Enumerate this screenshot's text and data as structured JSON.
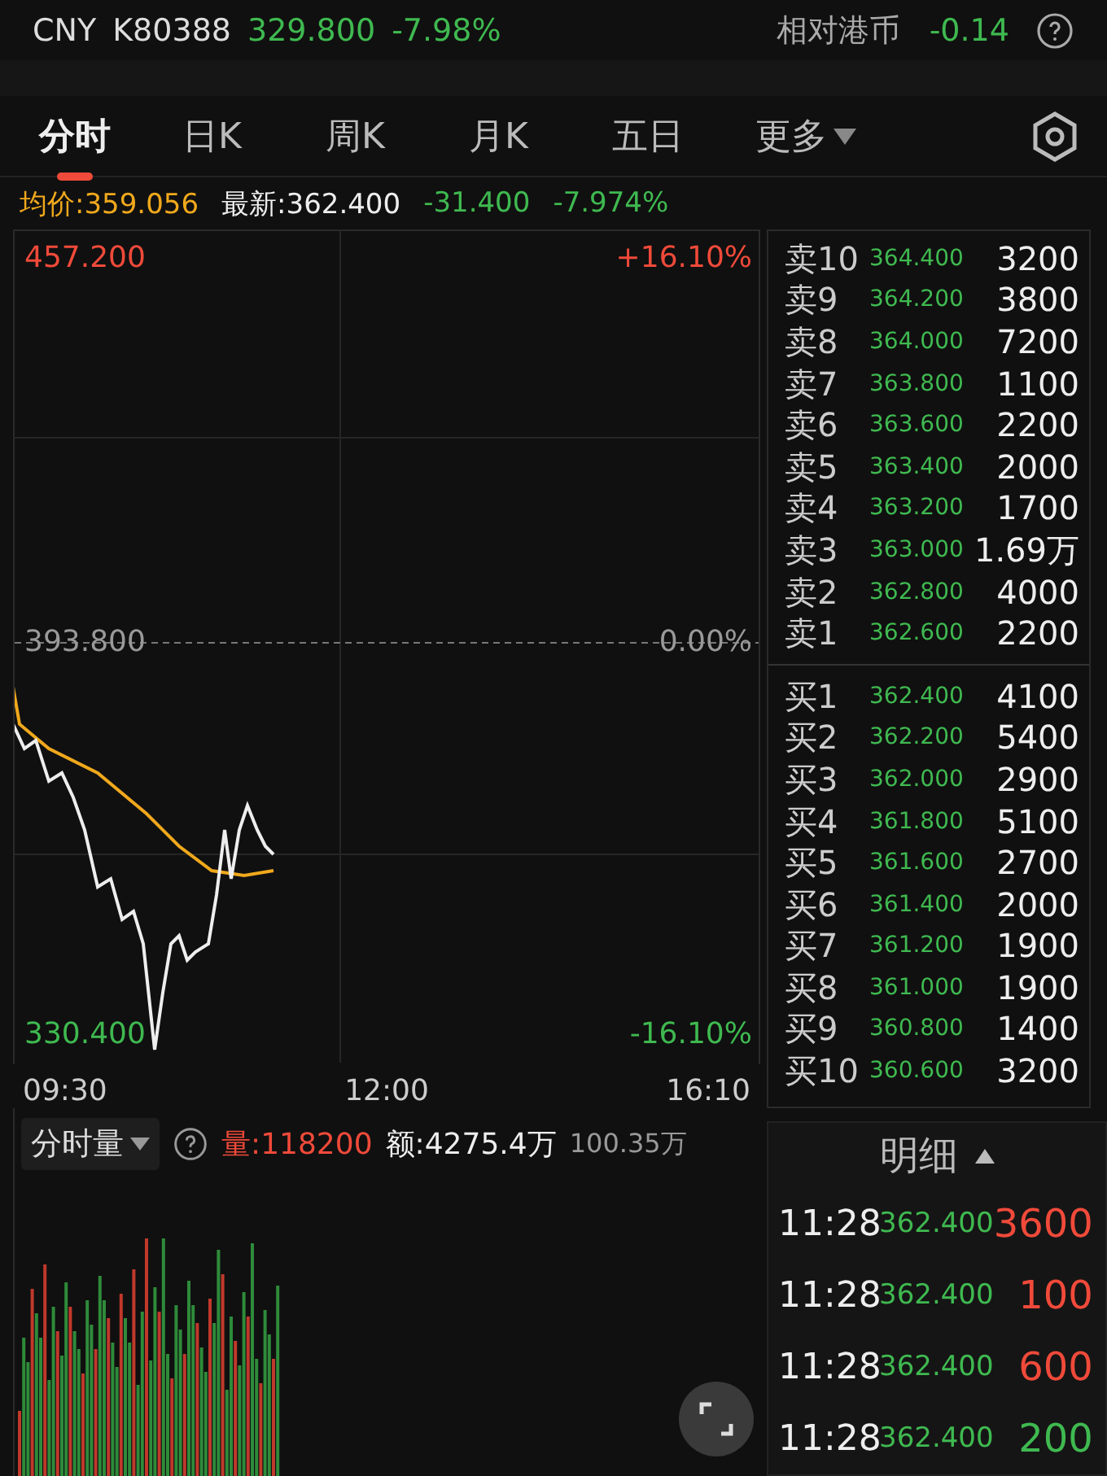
{
  "header": {
    "symbol": "CNY",
    "code": "K80388",
    "price": "329.800",
    "change": "-7.98%",
    "relative_label": "相对港币",
    "relative_value": "-0.14"
  },
  "tabs": [
    {
      "label": "分时",
      "selected": true,
      "kind": "plain"
    },
    {
      "label": "日K",
      "selected": false,
      "kind": "plain"
    },
    {
      "label": "周K",
      "selected": false,
      "kind": "plain"
    },
    {
      "label": "月K",
      "selected": false,
      "kind": "plain"
    },
    {
      "label": "五日",
      "selected": false,
      "kind": "plain"
    },
    {
      "label": "更多",
      "selected": false,
      "kind": "dropdown"
    }
  ],
  "info": {
    "average": "均价:359.056",
    "latest": "最新:362.400",
    "change": "-31.400",
    "change_pct": "-7.974%"
  },
  "chart": {
    "high": "457.200",
    "high_pct": "+16.10%",
    "mid": "393.800",
    "mid_pct": "0.00%",
    "low": "330.400",
    "low_pct": "-16.10%",
    "times": [
      "09:30",
      "12:00",
      "16:10"
    ]
  },
  "asks": [
    {
      "label": "卖10",
      "price": "364.400",
      "qty": "3200"
    },
    {
      "label": "卖9",
      "price": "364.200",
      "qty": "3800"
    },
    {
      "label": "卖8",
      "price": "364.000",
      "qty": "7200"
    },
    {
      "label": "卖7",
      "price": "363.800",
      "qty": "1100"
    },
    {
      "label": "卖6",
      "price": "363.600",
      "qty": "2200"
    },
    {
      "label": "卖5",
      "price": "363.400",
      "qty": "2000"
    },
    {
      "label": "卖4",
      "price": "363.200",
      "qty": "1700"
    },
    {
      "label": "卖3",
      "price": "363.000",
      "qty": "1.69万"
    },
    {
      "label": "卖2",
      "price": "362.800",
      "qty": "4000"
    },
    {
      "label": "卖1",
      "price": "362.600",
      "qty": "2200"
    }
  ],
  "bids": [
    {
      "label": "买1",
      "price": "362.400",
      "qty": "4100"
    },
    {
      "label": "买2",
      "price": "362.200",
      "qty": "5400"
    },
    {
      "label": "买3",
      "price": "362.000",
      "qty": "2900"
    },
    {
      "label": "买4",
      "price": "361.800",
      "qty": "5100"
    },
    {
      "label": "买5",
      "price": "361.600",
      "qty": "2700"
    },
    {
      "label": "买6",
      "price": "361.400",
      "qty": "2000"
    },
    {
      "label": "买7",
      "price": "361.200",
      "qty": "1900"
    },
    {
      "label": "买8",
      "price": "361.000",
      "qty": "1900"
    },
    {
      "label": "买9",
      "price": "360.800",
      "qty": "1400"
    },
    {
      "label": "买10",
      "price": "360.600",
      "qty": "3200"
    }
  ],
  "volume": {
    "selector": "分时量",
    "amount_volume": "量:118200",
    "amount_value": "额:4275.4万",
    "max": "100.35万"
  },
  "trades": {
    "title": "明细",
    "rows": [
      {
        "time": "11:28",
        "price": "362.400",
        "qty": "3600",
        "color": "#f04a3a"
      },
      {
        "time": "11:28",
        "price": "362.400",
        "qty": "100",
        "color": "#f04a3a"
      },
      {
        "time": "11:28",
        "price": "362.400",
        "qty": "600",
        "color": "#f04a3a"
      },
      {
        "time": "11:28",
        "price": "362.400",
        "qty": "200",
        "color": "#3fb950"
      }
    ]
  }
}
